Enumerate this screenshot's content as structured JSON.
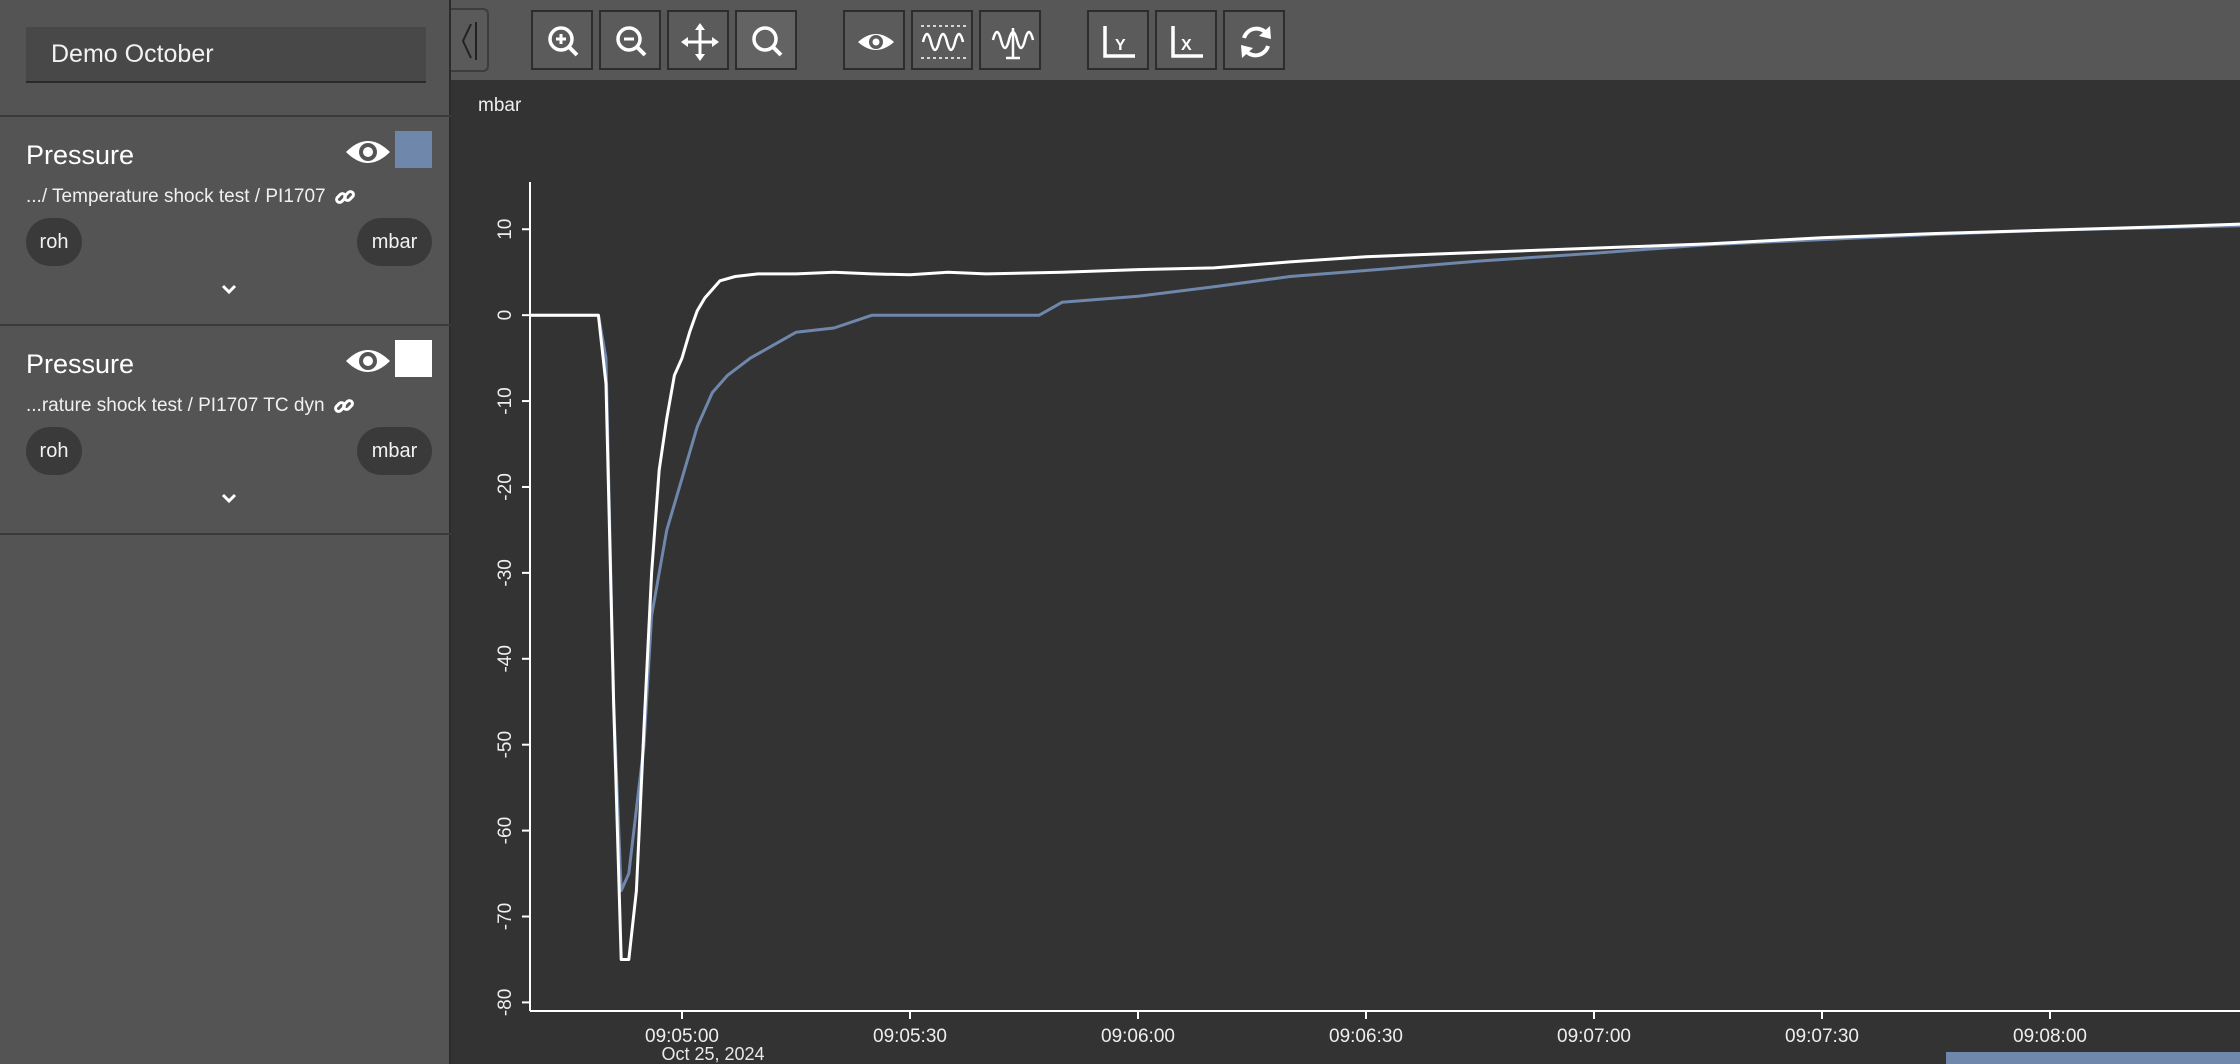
{
  "sidebar": {
    "title": "Demo October",
    "series": [
      {
        "name": "Pressure",
        "path": ".../ Temperature shock test / PI1707",
        "chip_left": "roh",
        "chip_right": "mbar",
        "color": "#6f87ab"
      },
      {
        "name": "Pressure",
        "path": "...rature shock test / PI1707 TC dyn",
        "chip_left": "roh",
        "chip_right": "mbar",
        "color": "#ffffff"
      }
    ]
  },
  "toolbar": {
    "buttons": [
      {
        "name": "zoom-in",
        "icon": "zoom-in-icon"
      },
      {
        "name": "zoom-out",
        "icon": "zoom-out-icon"
      },
      {
        "name": "pan",
        "icon": "move-icon"
      },
      {
        "name": "zoom-select",
        "icon": "search-icon"
      },
      {
        "name": "visibility",
        "icon": "eye-icon"
      },
      {
        "name": "fit-signal",
        "icon": "wave-bounds-icon"
      },
      {
        "name": "signal-range",
        "icon": "wave-range-icon"
      },
      {
        "name": "axis-y",
        "icon": "axis-y-icon"
      },
      {
        "name": "axis-x",
        "icon": "axis-x-icon"
      },
      {
        "name": "refresh",
        "icon": "refresh-icon"
      }
    ]
  },
  "chart_data": {
    "type": "line",
    "title": "",
    "ylabel": "mbar",
    "xlabel": "",
    "x_date_label": "Oct 25, 2024",
    "xlim": [
      "09:04:40",
      "09:08:25"
    ],
    "ylim": [
      -81,
      15
    ],
    "y_ticks": [
      10,
      0,
      -10,
      -20,
      -30,
      -40,
      -50,
      -60,
      -70,
      -80
    ],
    "x_ticks": [
      "09:05:00",
      "09:05:30",
      "09:06:00",
      "09:06:30",
      "09:07:00",
      "09:07:30",
      "09:08:00"
    ],
    "grid": false,
    "series": [
      {
        "color": "#6f87ab",
        "x": [
          "09:04:40",
          "09:04:49",
          "09:04:50",
          "09:04:51",
          "09:04:52",
          "09:04:53",
          "09:04:55",
          "09:04:56",
          "09:04:58",
          "09:05:00",
          "09:05:02",
          "09:05:04",
          "09:05:06",
          "09:05:09",
          "09:05:12",
          "09:05:15",
          "09:05:20",
          "09:05:25",
          "09:05:30",
          "09:05:33",
          "09:05:40",
          "09:05:47",
          "09:05:50",
          "09:06:00",
          "09:06:10",
          "09:06:20",
          "09:06:30",
          "09:06:45",
          "09:07:00",
          "09:07:15",
          "09:07:30",
          "09:07:45",
          "09:08:00",
          "09:08:15",
          "09:08:25"
        ],
        "values": [
          0,
          0,
          -5,
          -45,
          -67,
          -65,
          -50,
          -35,
          -25,
          -19,
          -13,
          -9,
          -7,
          -5,
          -3.5,
          -2,
          -1.5,
          0,
          0,
          0,
          0,
          0,
          1.5,
          2.2,
          3.3,
          4.5,
          5.2,
          6.3,
          7.2,
          8.2,
          8.8,
          9.4,
          9.9,
          10.2,
          10.4
        ]
      },
      {
        "color": "#ffffff",
        "x": [
          "09:04:40",
          "09:04:49",
          "09:04:50",
          "09:04:51",
          "09:04:52",
          "09:04:53",
          "09:04:54",
          "09:04:55",
          "09:04:56",
          "09:04:57",
          "09:04:58",
          "09:04:59",
          "09:05:00",
          "09:05:01",
          "09:05:02",
          "09:05:03",
          "09:05:05",
          "09:05:07",
          "09:05:10",
          "09:05:15",
          "09:05:20",
          "09:05:25",
          "09:05:30",
          "09:05:35",
          "09:05:40",
          "09:05:50",
          "09:06:00",
          "09:06:10",
          "09:06:20",
          "09:06:30",
          "09:06:45",
          "09:07:00",
          "09:07:15",
          "09:07:30",
          "09:07:45",
          "09:08:00",
          "09:08:15",
          "09:08:25"
        ],
        "values": [
          0,
          0,
          -8,
          -45,
          -75,
          -75,
          -67,
          -48,
          -30,
          -18,
          -12,
          -7,
          -5,
          -2,
          0.5,
          2,
          4,
          4.5,
          4.8,
          4.8,
          5,
          4.8,
          4.7,
          5,
          4.8,
          5,
          5.3,
          5.5,
          6.2,
          6.8,
          7.3,
          7.8,
          8.3,
          9,
          9.5,
          9.9,
          10.3,
          10.6
        ]
      }
    ]
  }
}
